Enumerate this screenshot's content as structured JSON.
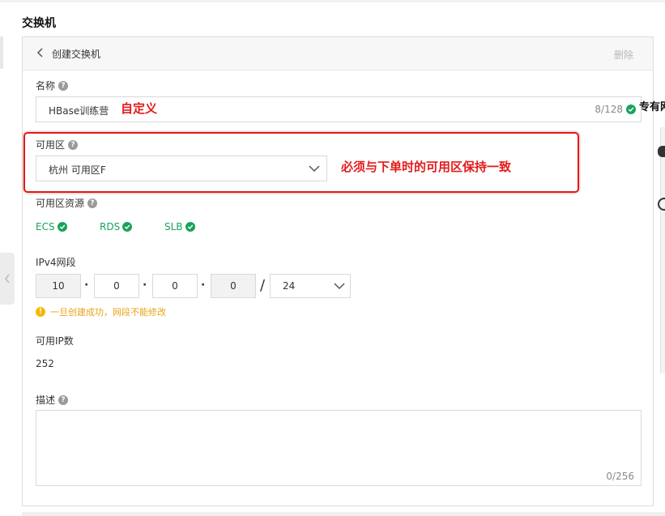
{
  "section_title": "交换机",
  "header": {
    "title": "创建交换机",
    "delete_label": "删除"
  },
  "name_field": {
    "label": "名称",
    "value": "HBase训练营",
    "counter": "8/128"
  },
  "zone_field": {
    "label": "可用区",
    "value": "杭州 可用区F"
  },
  "zone_resources": {
    "label": "可用区资源",
    "items": [
      {
        "label": "ECS"
      },
      {
        "label": "RDS"
      },
      {
        "label": "SLB"
      }
    ]
  },
  "ipv4": {
    "label": "IPv4网段",
    "octets": [
      "10",
      "0",
      "0",
      "0"
    ],
    "separator": "/",
    "mask": "24",
    "warning": "一旦创建成功，网段不能修改"
  },
  "available_ip": {
    "label": "可用IP数",
    "value": "252"
  },
  "description_field": {
    "label": "描述",
    "value": "",
    "counter": "0/256"
  },
  "annotations": {
    "name_note": "自定义",
    "zone_note": "必须与下单时的可用区保持一致"
  },
  "right_peek": {
    "text": "专有网"
  },
  "colors": {
    "success": "#1aa35d",
    "warning": "#f5b800",
    "annotation": "#e31b1b"
  }
}
